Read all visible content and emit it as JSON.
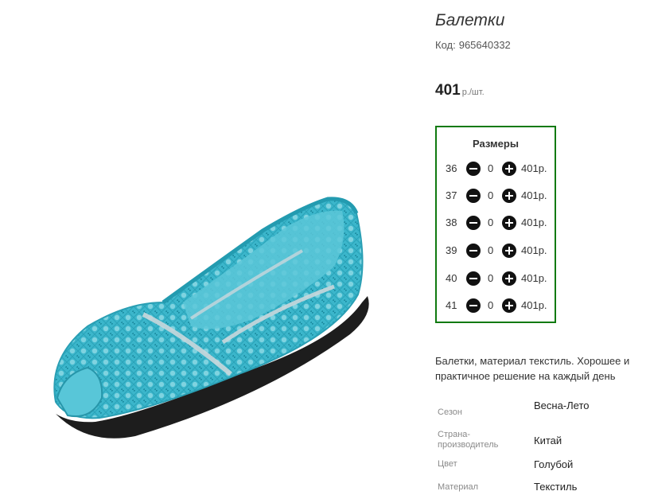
{
  "product": {
    "title": "Балетки",
    "code_label": "Код:",
    "code_value": "965640332",
    "price_amount": "401",
    "price_unit": "р./шт.",
    "image_alt": "turquoise-crochet-ballet-flat"
  },
  "sizes": {
    "title": "Размеры",
    "rows": [
      {
        "size": "36",
        "qty": "0",
        "price": "401р."
      },
      {
        "size": "37",
        "qty": "0",
        "price": "401р."
      },
      {
        "size": "38",
        "qty": "0",
        "price": "401р."
      },
      {
        "size": "39",
        "qty": "0",
        "price": "401р."
      },
      {
        "size": "40",
        "qty": "0",
        "price": "401р."
      },
      {
        "size": "41",
        "qty": "0",
        "price": "401р."
      }
    ]
  },
  "description": "Балетки, материал текстиль. Хорошее и практичное решение на каждый день",
  "properties": [
    {
      "name": "Сезон",
      "value": "Весна-Лето"
    },
    {
      "name": "Страна-производитель",
      "value": "Китай"
    },
    {
      "name": "Цвет",
      "value": "Голубой"
    },
    {
      "name": "Материал",
      "value": "Текстиль"
    }
  ],
  "colors": {
    "border_green": "#0f7a0f",
    "shoe_turquoise": "#3ab7cc"
  },
  "icons": {
    "minus": "minus-circle-icon",
    "plus": "plus-circle-icon"
  }
}
